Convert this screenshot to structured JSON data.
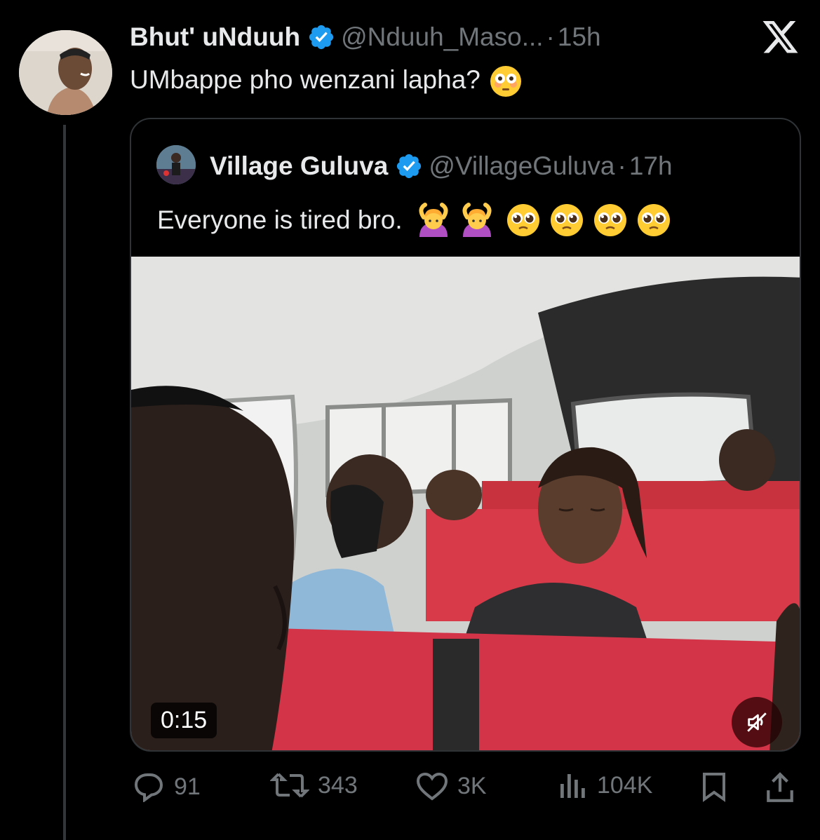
{
  "tweet": {
    "author_name": "Bhut' uNduuh",
    "handle": "@Nduuh_Maso...",
    "separator": "·",
    "time": "15h",
    "text": "UMbappe pho wenzani lapha?",
    "emoji_name": "flushed-face-emoji"
  },
  "quote": {
    "author_name": "Village Guluva",
    "handle": "@VillageGuluva",
    "separator": "·",
    "time": "17h",
    "text": "Everyone is tired bro.",
    "emojis": [
      "woman-gesturing-ok-emoji",
      "woman-gesturing-ok-emoji",
      "pleading-face-emoji",
      "pleading-face-emoji",
      "pleading-face-emoji",
      "pleading-face-emoji"
    ],
    "video": {
      "timestamp": "0:15",
      "muted": true
    }
  },
  "actions": {
    "replies": "91",
    "retweets": "343",
    "likes": "3K",
    "views": "104K"
  },
  "colors": {
    "background": "#000000",
    "text": "#e7e9ea",
    "muted": "#71767b",
    "verified": "#1d9bf0",
    "border": "#2f3336"
  }
}
